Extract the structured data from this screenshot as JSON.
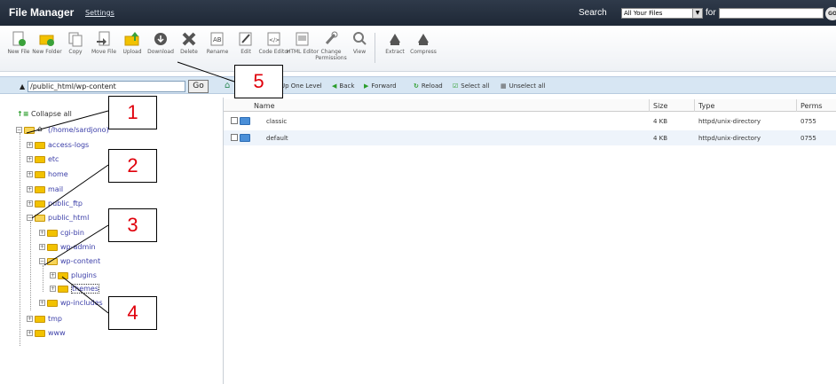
{
  "header": {
    "title": "File Manager",
    "settings_link": "Settings",
    "search_label": "Search",
    "search_scope": "All Your Files",
    "for_label": "for",
    "search_value": "",
    "go_label": "GO"
  },
  "toolbar": {
    "items": [
      {
        "label": "New File",
        "icon": "new-file-icon"
      },
      {
        "label": "New Folder",
        "icon": "new-folder-icon"
      },
      {
        "label": "Copy",
        "icon": "copy-icon"
      },
      {
        "label": "Move File",
        "icon": "move-file-icon"
      },
      {
        "label": "Upload",
        "icon": "upload-icon"
      },
      {
        "label": "Download",
        "icon": "download-icon"
      },
      {
        "label": "Delete",
        "icon": "delete-icon"
      },
      {
        "label": "Rename",
        "icon": "rename-icon"
      },
      {
        "label": "Edit",
        "icon": "edit-icon"
      },
      {
        "label": "Code Editor",
        "icon": "code-editor-icon"
      },
      {
        "label": "HTML Editor",
        "icon": "html-editor-icon"
      },
      {
        "label": "Change Permissions",
        "icon": "permissions-icon"
      },
      {
        "label": "View",
        "icon": "view-icon"
      },
      {
        "label": "Extract",
        "icon": "extract-icon"
      },
      {
        "label": "Compress",
        "icon": "compress-icon"
      }
    ]
  },
  "pathbar": {
    "path_value": "/public_html/wp-content",
    "go_label": "Go",
    "up_label": "Up One Level",
    "back_label": "Back",
    "forward_label": "Forward",
    "reload_label": "Reload",
    "select_all_label": "Select all",
    "unselect_all_label": "Unselect all"
  },
  "tree": {
    "collapse_all": "Collapse all",
    "home": "(/home/sardjono)",
    "items": [
      "access-logs",
      "etc",
      "home",
      "mail",
      "public_ftp",
      "public_html",
      "cgi-bin",
      "wp-admin",
      "wp-content",
      "plugins",
      "themes",
      "wp-includes",
      "tmp",
      "www"
    ]
  },
  "table": {
    "headers": {
      "name": "Name",
      "size": "Size",
      "type": "Type",
      "perms": "Perms"
    },
    "rows": [
      {
        "name": "classic",
        "size": "4 KB",
        "type": "httpd/unix-directory",
        "perms": "0755"
      },
      {
        "name": "default",
        "size": "4 KB",
        "type": "httpd/unix-directory",
        "perms": "0755"
      }
    ]
  },
  "callouts": [
    "1",
    "2",
    "3",
    "4",
    "5"
  ]
}
